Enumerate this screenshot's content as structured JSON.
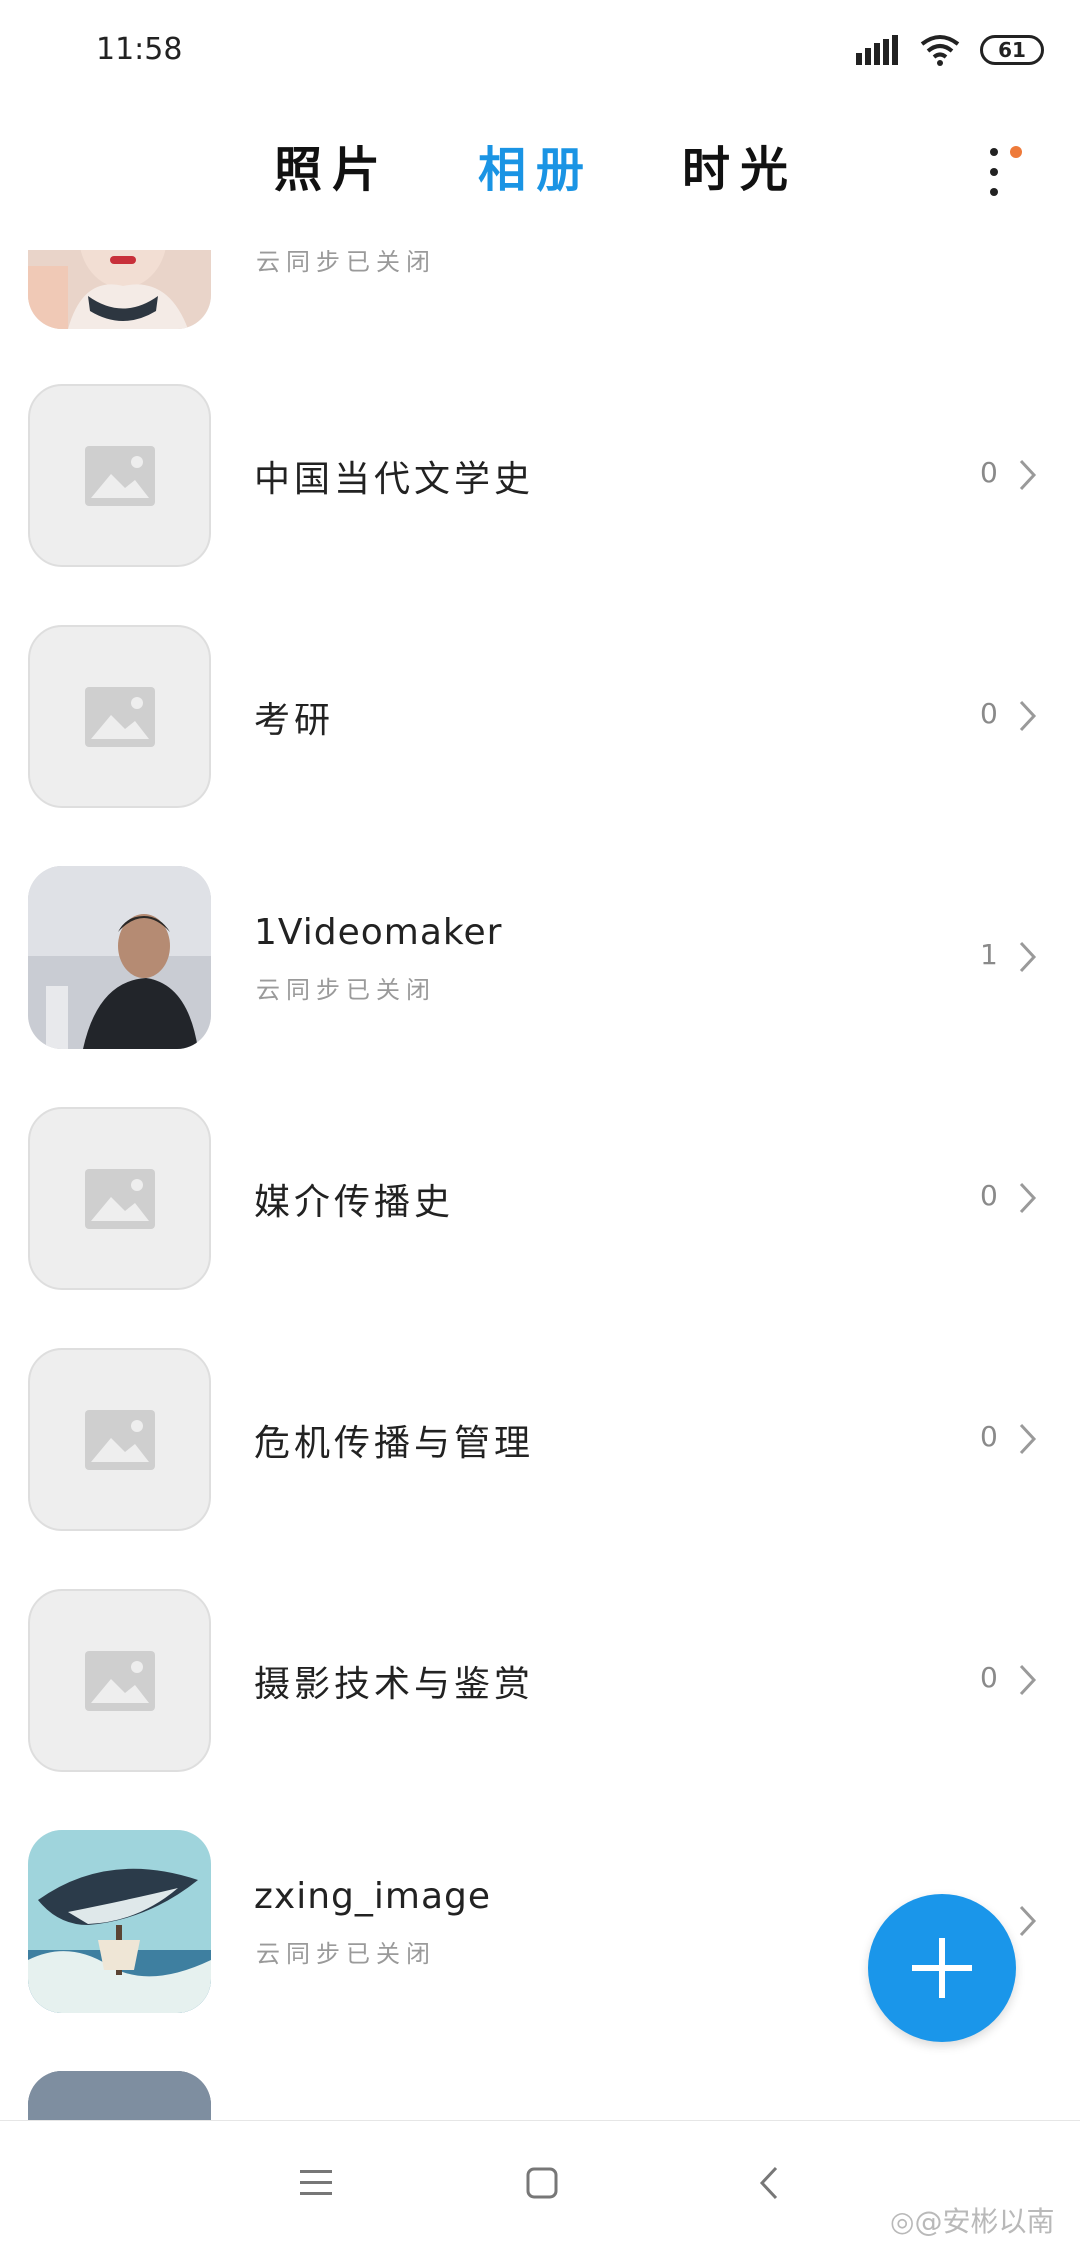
{
  "status_bar": {
    "time": "11:58",
    "battery": "61"
  },
  "tabs": [
    {
      "label": "照片"
    },
    {
      "label": "相册",
      "active": true
    },
    {
      "label": "时光"
    }
  ],
  "albums": [
    {
      "name": "",
      "subtitle": "云同步已关闭",
      "count": "",
      "thumb": "photo-person-scarf"
    },
    {
      "name": "中国当代文学史",
      "subtitle": "",
      "count": "0",
      "thumb": "placeholder"
    },
    {
      "name": "考研",
      "subtitle": "",
      "count": "0",
      "thumb": "placeholder"
    },
    {
      "name": "1Videomaker",
      "subtitle": "云同步已关闭",
      "count": "1",
      "thumb": "photo-man-portrait"
    },
    {
      "name": "媒介传播史",
      "subtitle": "",
      "count": "0",
      "thumb": "placeholder"
    },
    {
      "name": "危机传播与管理",
      "subtitle": "",
      "count": "0",
      "thumb": "placeholder"
    },
    {
      "name": "摄影技术与鉴赏",
      "subtitle": "",
      "count": "0",
      "thumb": "placeholder"
    },
    {
      "name": "zxing_image",
      "subtitle": "云同步已关闭",
      "count": "",
      "thumb": "photo-whale-ship"
    }
  ],
  "fab": {
    "icon": "plus-icon"
  },
  "watermark": "@安彬以南",
  "colors": {
    "accent": "#1a94e4",
    "fab": "#1a96ea",
    "notification_dot": "#ee7a3a"
  }
}
